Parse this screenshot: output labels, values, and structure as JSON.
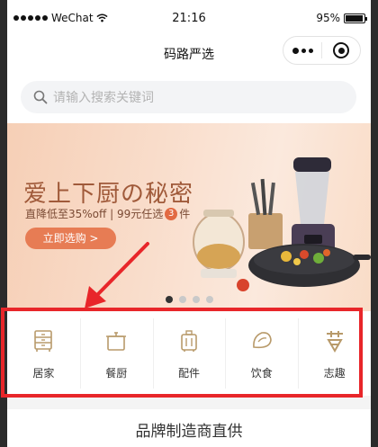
{
  "status_bar": {
    "carrier": "WeChat",
    "time": "21:16",
    "battery": "95%",
    "battery_level": 0.95
  },
  "nav": {
    "title": "码路严选"
  },
  "search": {
    "placeholder": "请输入搜索关键词"
  },
  "banner": {
    "headline": "爱上下厨の秘密",
    "subline_prefix": "直降低至35%off | 99元任选",
    "subline_badge": "3",
    "subline_suffix": "件",
    "cta": "立即选购 >",
    "slide_count": 4,
    "active_slide": 1
  },
  "categories": [
    {
      "label": "居家",
      "icon": "cabinet-icon"
    },
    {
      "label": "餐厨",
      "icon": "pot-icon"
    },
    {
      "label": "配件",
      "icon": "suitcase-icon"
    },
    {
      "label": "饮食",
      "icon": "snack-icon"
    },
    {
      "label": "志趣",
      "icon": "hobby-icon"
    }
  ],
  "brand_section": {
    "title": "品牌制造商直供"
  },
  "colors": {
    "accent": "#e77c54",
    "highlight_box": "#e8262a",
    "icon_gold": "#b89a6a"
  }
}
